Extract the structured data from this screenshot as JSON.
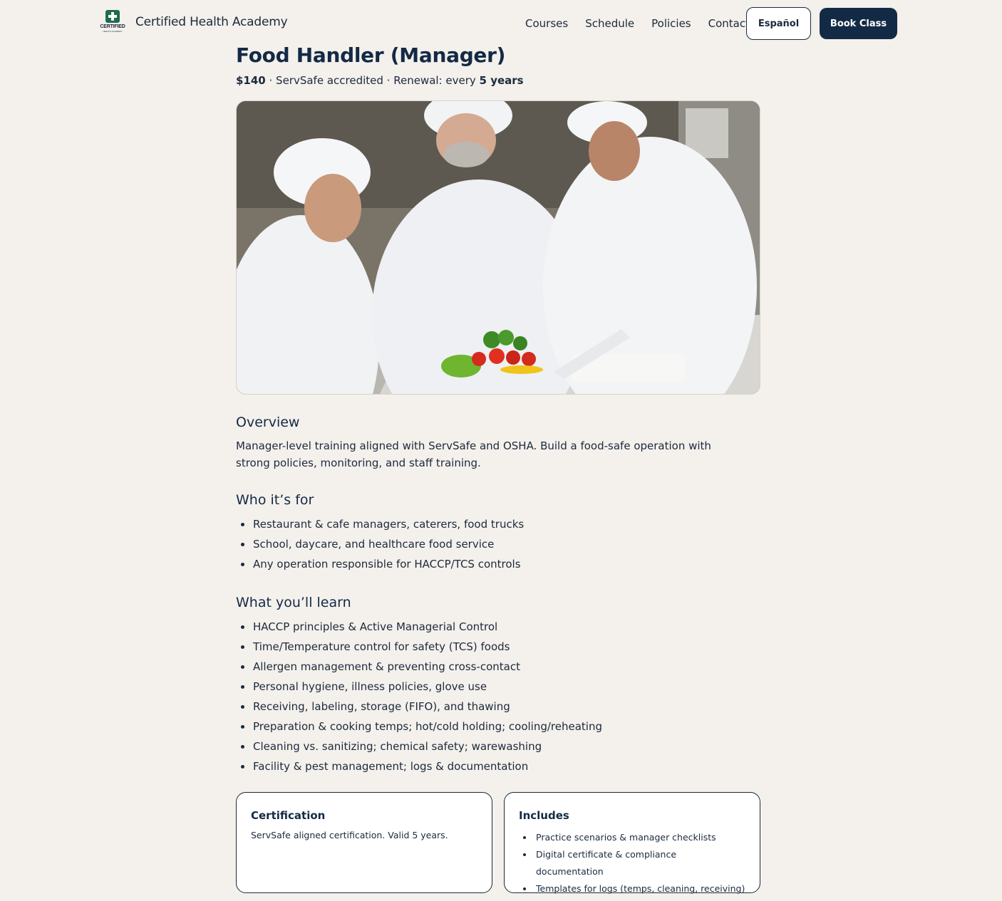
{
  "header": {
    "logo_text": "CERTIFIED",
    "logo_subtext": "HEALTH ACADEMY",
    "brand": "Certified Health Academy",
    "nav": [
      "Courses",
      "Schedule",
      "Policies",
      "Contact"
    ],
    "language_button": "Español",
    "book_button": "Book Class"
  },
  "course": {
    "title": "Food Handler (Manager)",
    "price": "$140",
    "meta_middle": " · ServSafe accredited · Renewal: every ",
    "renewal": "5 years",
    "hero_image": "chefs-preparing-vegetables-photo"
  },
  "overview": {
    "heading": "Overview",
    "text": "Manager-level training aligned with ServSafe and OSHA. Build a food-safe operation with strong policies, monitoring, and staff training."
  },
  "who": {
    "heading": "Who it’s for",
    "items": [
      "Restaurant & cafe managers, caterers, food trucks",
      "School, daycare, and healthcare food service",
      "Any operation responsible for HACCP/TCS controls"
    ]
  },
  "learn": {
    "heading": "What you’ll learn",
    "items": [
      "HACCP principles & Active Managerial Control",
      "Time/Temperature control for safety (TCS) foods",
      "Allergen management & preventing cross-contact",
      "Personal hygiene, illness policies, glove use",
      "Receiving, labeling, storage (FIFO), and thawing",
      "Preparation & cooking temps; hot/cold holding; cooling/reheating",
      "Cleaning vs. sanitizing; chemical safety; warewashing",
      "Facility & pest management; logs & documentation"
    ]
  },
  "certification": {
    "heading": "Certification",
    "text": "ServSafe aligned certification. Valid 5 years."
  },
  "includes": {
    "heading": "Includes",
    "items": [
      "Practice scenarios & manager checklists",
      "Digital certificate & compliance documentation",
      "Templates for logs (temps, cleaning, receiving)"
    ]
  }
}
